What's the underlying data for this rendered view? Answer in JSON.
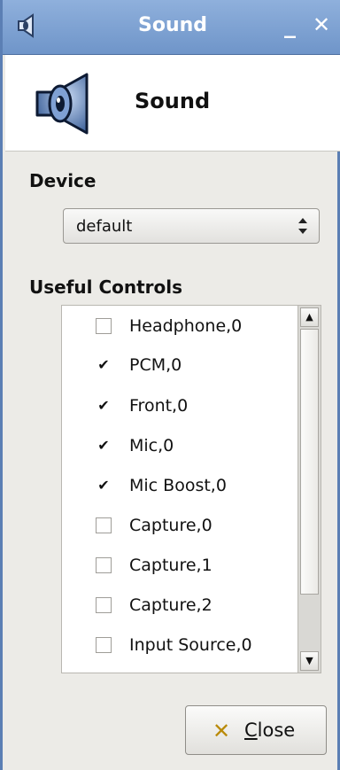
{
  "window": {
    "title": "Sound"
  },
  "header": {
    "title": "Sound",
    "icon": "speaker-icon"
  },
  "device": {
    "label": "Device",
    "selected": "default"
  },
  "controls": {
    "label": "Useful Controls",
    "items": [
      {
        "label": "Headphone,0",
        "checked": false
      },
      {
        "label": "PCM,0",
        "checked": true
      },
      {
        "label": "Front,0",
        "checked": true
      },
      {
        "label": "Mic,0",
        "checked": true
      },
      {
        "label": "Mic Boost,0",
        "checked": true
      },
      {
        "label": "Capture,0",
        "checked": false
      },
      {
        "label": "Capture,1",
        "checked": false
      },
      {
        "label": "Capture,2",
        "checked": false
      },
      {
        "label": "Input Source,0",
        "checked": false
      }
    ]
  },
  "buttons": {
    "close_label_first": "C",
    "close_label_rest": "lose"
  },
  "colors": {
    "titlebar": "#7b9fd2",
    "accent": "#5b7fb4"
  }
}
